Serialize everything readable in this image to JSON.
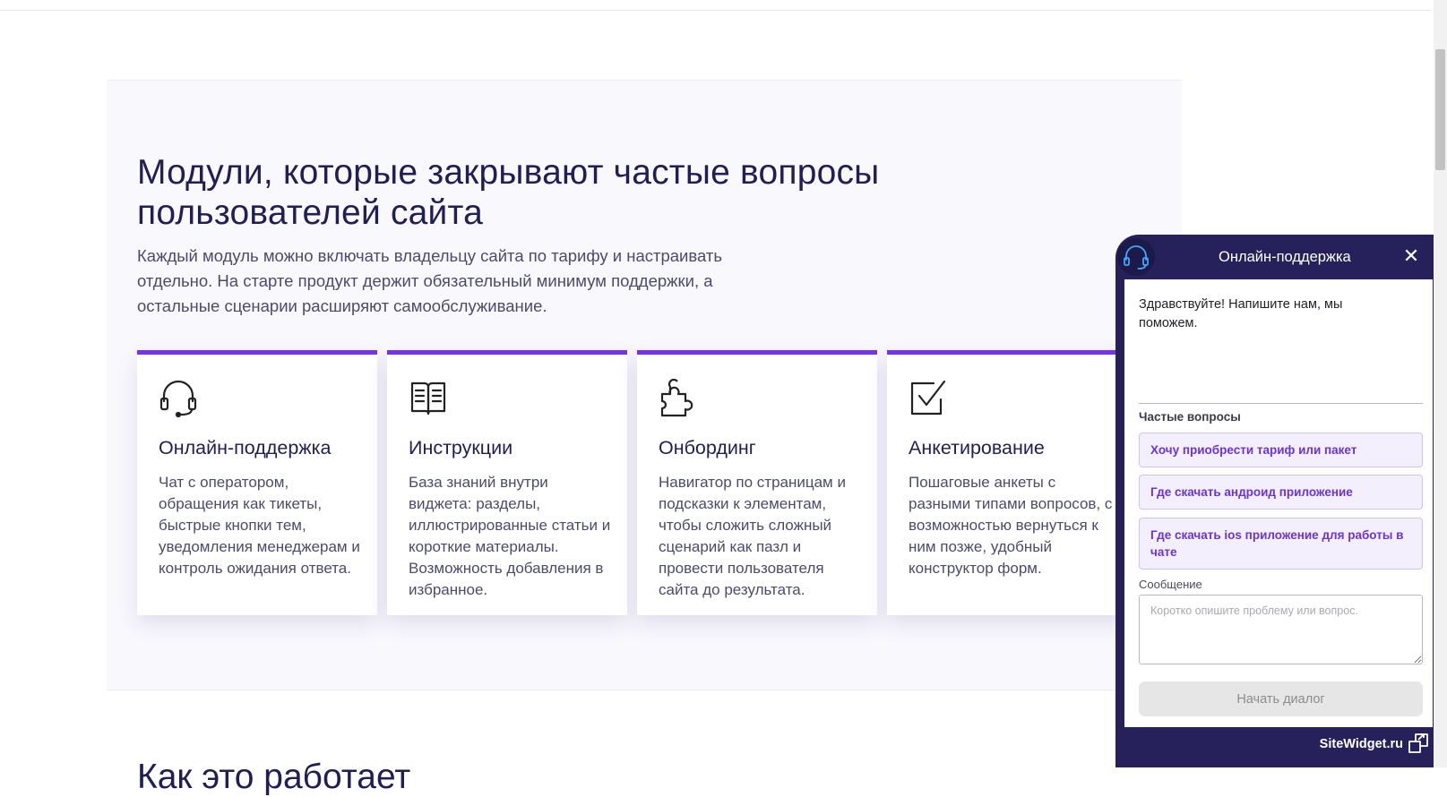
{
  "section": {
    "title": "Модули, которые закрывают частые вопросы пользователей сайта",
    "subtitle": "Каждый модуль можно включать владельцу сайта по тарифу и настраивать отдельно. На старте продукт держит обязательный минимум поддержки, а остальные сценарии расширяют самообслуживание.",
    "cards": [
      {
        "icon": "headset-icon",
        "title": "Онлайн-поддержка",
        "text": "Чат с оператором, обращения как тикеты, быстрые кнопки тем, уведомления менеджерам и контроль ожидания ответа."
      },
      {
        "icon": "book-icon",
        "title": "Инструкции",
        "text": "База знаний внутри виджета: разделы, иллюстрированные статьи и короткие материалы. Возможность добавления в избранное."
      },
      {
        "icon": "puzzle-icon",
        "title": "Онбординг",
        "text": "Навигатор по страницам и подсказки к элементам, чтобы сложить сложный сценарий как пазл и провести пользователя сайта до результата."
      },
      {
        "icon": "checkbox-icon",
        "title": "Анкетирование",
        "text": "Пошаговые анкеты с разными типами вопросов, с возможностью вернуться к ним позже, удобный конструктор форм."
      }
    ],
    "accent_color": "#7433e6"
  },
  "next_section": {
    "title": "Как это работает"
  },
  "widget": {
    "title": "Онлайн-поддержка",
    "greeting": "Здравствуйте! Напишите нам, мы поможем.",
    "faq_label": "Частые вопросы",
    "faq": [
      "Хочу приобрести тариф или пакет",
      "Где скачать андроид приложение",
      "Где скачать ios приложение для работы в чате"
    ],
    "message_label": "Сообщение",
    "message_placeholder": "Коротко опишите проблему или вопрос.",
    "start_button": "Начать диалог",
    "brand": "SiteWidget.ru",
    "header_color": "#26215a"
  }
}
